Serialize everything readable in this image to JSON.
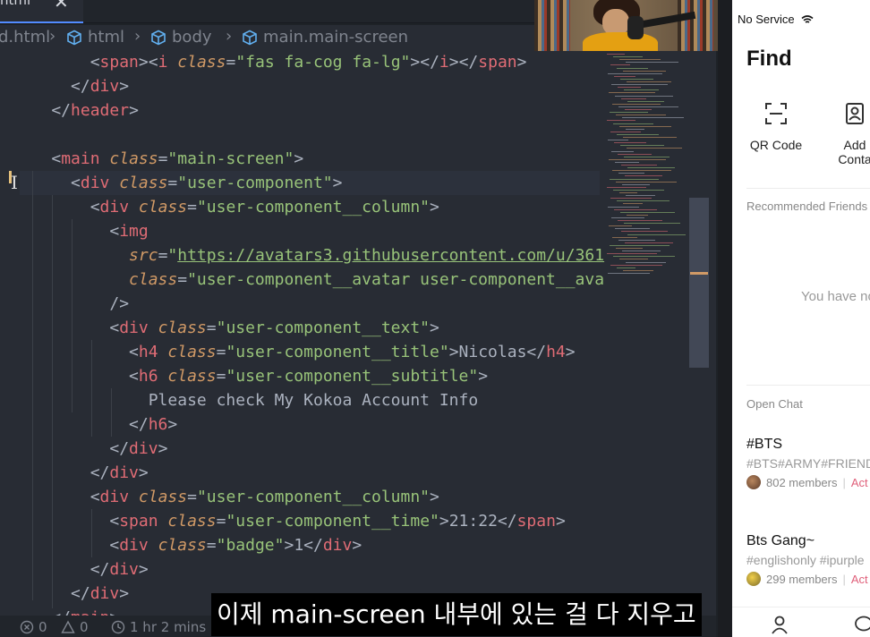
{
  "editor": {
    "tab": {
      "label": "html",
      "close": "✕"
    },
    "breadcrumb": [
      "d.html",
      "html",
      "body",
      "main.main-screen"
    ],
    "lines": [
      [
        [
          "t-punc",
          "        <"
        ],
        [
          "t-tag",
          "span"
        ],
        [
          "t-punc",
          "><"
        ],
        [
          "t-tag",
          "i"
        ],
        [
          "t-punc",
          " "
        ],
        [
          "t-attr",
          "class"
        ],
        [
          "t-punc",
          "="
        ],
        [
          "t-str",
          "\"fas fa-cog fa-lg\""
        ],
        [
          "t-punc",
          "></"
        ],
        [
          "t-tag",
          "i"
        ],
        [
          "t-punc",
          "></"
        ],
        [
          "t-tag",
          "span"
        ],
        [
          "t-punc",
          ">"
        ]
      ],
      [
        [
          "t-punc",
          "      </"
        ],
        [
          "t-tag",
          "div"
        ],
        [
          "t-punc",
          ">"
        ]
      ],
      [
        [
          "t-punc",
          "    </"
        ],
        [
          "t-tag",
          "header"
        ],
        [
          "t-punc",
          ">"
        ]
      ],
      [],
      [
        [
          "t-punc",
          "    <"
        ],
        [
          "t-tag",
          "main"
        ],
        [
          "t-punc",
          " "
        ],
        [
          "t-attr",
          "class"
        ],
        [
          "t-punc",
          "="
        ],
        [
          "t-str",
          "\"main-screen\""
        ],
        [
          "t-punc",
          ">"
        ]
      ],
      [
        [
          "t-punc",
          "      <"
        ],
        [
          "t-tag",
          "div"
        ],
        [
          "t-punc",
          " "
        ],
        [
          "t-attr",
          "class"
        ],
        [
          "t-punc",
          "="
        ],
        [
          "t-str",
          "\"user-component\""
        ],
        [
          "t-punc",
          ">"
        ]
      ],
      [
        [
          "t-punc",
          "        <"
        ],
        [
          "t-tag",
          "div"
        ],
        [
          "t-punc",
          " "
        ],
        [
          "t-attr",
          "class"
        ],
        [
          "t-punc",
          "="
        ],
        [
          "t-str",
          "\"user-component__column\""
        ],
        [
          "t-punc",
          ">"
        ]
      ],
      [
        [
          "t-punc",
          "          <"
        ],
        [
          "t-tag",
          "img"
        ]
      ],
      [
        [
          "t-punc",
          "            "
        ],
        [
          "t-attr",
          "src"
        ],
        [
          "t-punc",
          "="
        ],
        [
          "t-str",
          "\""
        ],
        [
          "t-url",
          "https://avatars3.githubusercontent.com/u/361"
        ]
      ],
      [
        [
          "t-punc",
          "            "
        ],
        [
          "t-attr",
          "class"
        ],
        [
          "t-punc",
          "="
        ],
        [
          "t-str",
          "\"user-component__avatar user-component__ava"
        ]
      ],
      [
        [
          "t-punc",
          "          />"
        ]
      ],
      [
        [
          "t-punc",
          "          <"
        ],
        [
          "t-tag",
          "div"
        ],
        [
          "t-punc",
          " "
        ],
        [
          "t-attr",
          "class"
        ],
        [
          "t-punc",
          "="
        ],
        [
          "t-str",
          "\"user-component__text\""
        ],
        [
          "t-punc",
          ">"
        ]
      ],
      [
        [
          "t-punc",
          "            <"
        ],
        [
          "t-tag",
          "h4"
        ],
        [
          "t-punc",
          " "
        ],
        [
          "t-attr",
          "class"
        ],
        [
          "t-punc",
          "="
        ],
        [
          "t-str",
          "\"user-component__title\""
        ],
        [
          "t-punc",
          ">"
        ],
        [
          "t-text",
          "Nicolas"
        ],
        [
          "t-punc",
          "</"
        ],
        [
          "t-tag",
          "h4"
        ],
        [
          "t-punc",
          ">"
        ]
      ],
      [
        [
          "t-punc",
          "            <"
        ],
        [
          "t-tag",
          "h6"
        ],
        [
          "t-punc",
          " "
        ],
        [
          "t-attr",
          "class"
        ],
        [
          "t-punc",
          "="
        ],
        [
          "t-str",
          "\"user-component__subtitle\""
        ],
        [
          "t-punc",
          ">"
        ]
      ],
      [
        [
          "t-text",
          "              Please check My Kokoa Account Info"
        ]
      ],
      [
        [
          "t-punc",
          "            </"
        ],
        [
          "t-tag",
          "h6"
        ],
        [
          "t-punc",
          ">"
        ]
      ],
      [
        [
          "t-punc",
          "          </"
        ],
        [
          "t-tag",
          "div"
        ],
        [
          "t-punc",
          ">"
        ]
      ],
      [
        [
          "t-punc",
          "        </"
        ],
        [
          "t-tag",
          "div"
        ],
        [
          "t-punc",
          ">"
        ]
      ],
      [
        [
          "t-punc",
          "        <"
        ],
        [
          "t-tag",
          "div"
        ],
        [
          "t-punc",
          " "
        ],
        [
          "t-attr",
          "class"
        ],
        [
          "t-punc",
          "="
        ],
        [
          "t-str",
          "\"user-component__column\""
        ],
        [
          "t-punc",
          ">"
        ]
      ],
      [
        [
          "t-punc",
          "          <"
        ],
        [
          "t-tag",
          "span"
        ],
        [
          "t-punc",
          " "
        ],
        [
          "t-attr",
          "class"
        ],
        [
          "t-punc",
          "="
        ],
        [
          "t-str",
          "\"user-component__time\""
        ],
        [
          "t-punc",
          ">"
        ],
        [
          "t-text",
          "21:22"
        ],
        [
          "t-punc",
          "</"
        ],
        [
          "t-tag",
          "span"
        ],
        [
          "t-punc",
          ">"
        ]
      ],
      [
        [
          "t-punc",
          "          <"
        ],
        [
          "t-tag",
          "div"
        ],
        [
          "t-punc",
          " "
        ],
        [
          "t-attr",
          "class"
        ],
        [
          "t-punc",
          "="
        ],
        [
          "t-str",
          "\"badge\""
        ],
        [
          "t-punc",
          ">"
        ],
        [
          "t-text",
          "1"
        ],
        [
          "t-punc",
          "</"
        ],
        [
          "t-tag",
          "div"
        ],
        [
          "t-punc",
          ">"
        ]
      ],
      [
        [
          "t-punc",
          "        </"
        ],
        [
          "t-tag",
          "div"
        ],
        [
          "t-punc",
          ">"
        ]
      ],
      [
        [
          "t-punc",
          "      </"
        ],
        [
          "t-tag",
          "div"
        ],
        [
          "t-punc",
          ">"
        ]
      ],
      [
        [
          "t-punc",
          "    </"
        ],
        [
          "t-tag",
          "main"
        ],
        [
          "t-punc",
          ">"
        ]
      ]
    ]
  },
  "statusbar": {
    "errors": "0",
    "warnings": "0",
    "time": "1 hr 2 mins"
  },
  "phone": {
    "status": "No Service",
    "title": "Find",
    "options": [
      {
        "label": "QR Code",
        "icon": "qr-scan-icon"
      },
      {
        "label": "Add Conta",
        "icon": "add-contact-icon"
      }
    ],
    "recommended_label": "Recommended Friends",
    "empty_message": "You have no",
    "open_chat_label": "Open Chat",
    "chats": [
      {
        "title": "#BTS",
        "tags": "#BTS#ARMY#FRIEND",
        "members": "802 members",
        "active": "Act"
      },
      {
        "title": "Bts Gang~",
        "tags": "#englishonly #ipurple",
        "members": "299 members",
        "active": "Act"
      }
    ]
  },
  "subtitle": "이제 main-screen 내부에 있는 걸 다 지우고",
  "colors": {
    "editor_bg": "#282c34",
    "tag": "#e06c75",
    "attr": "#d19a66",
    "string": "#98c379",
    "phone_bg": "#ffffff",
    "active_pink": "#e05f7a"
  }
}
